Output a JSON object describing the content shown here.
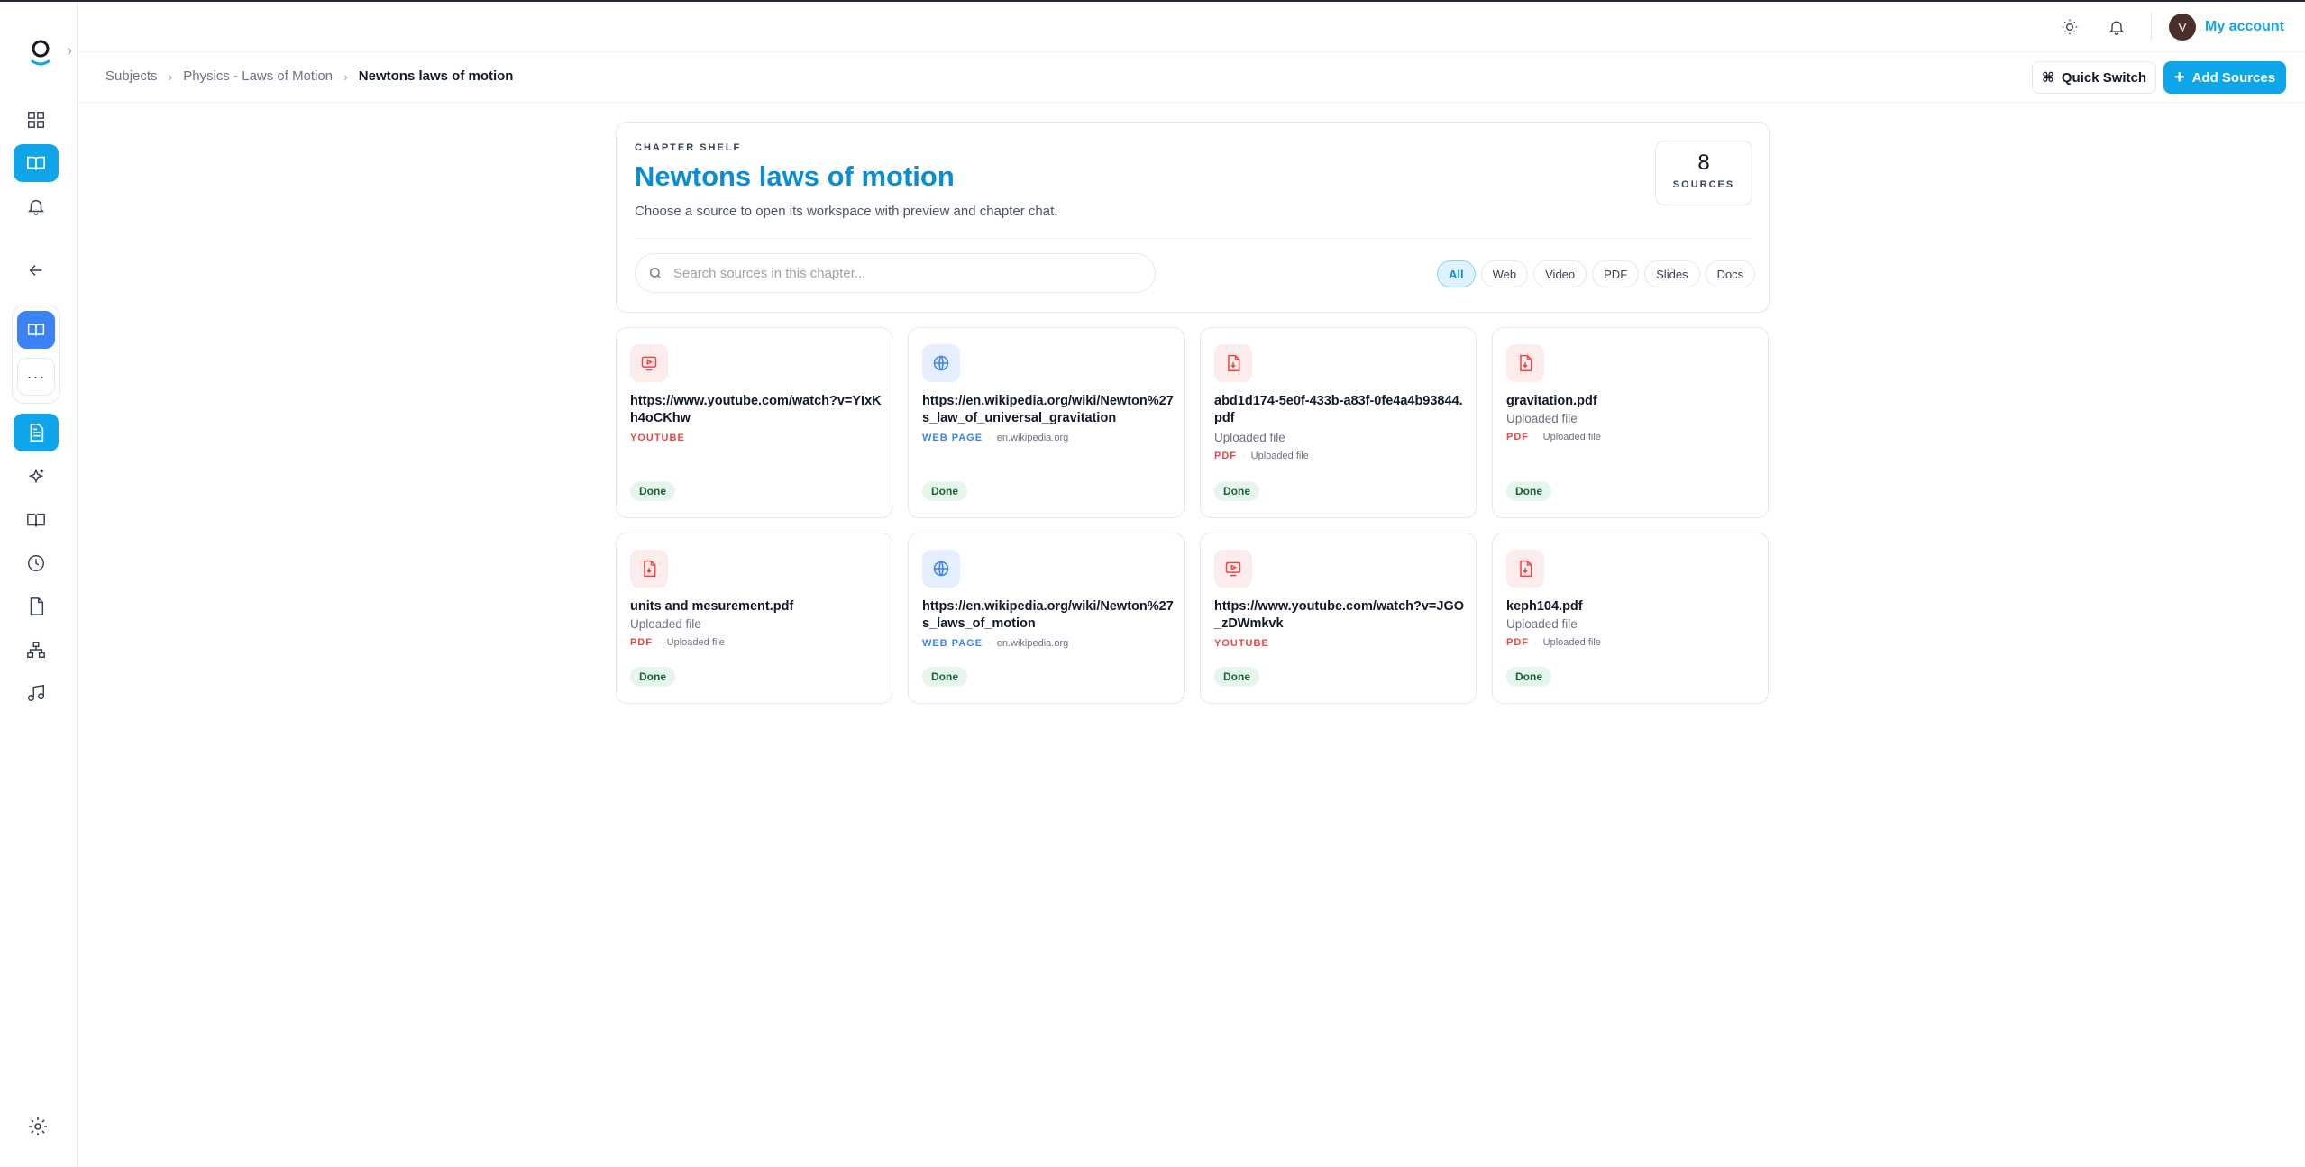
{
  "app": {
    "account_initial": "V",
    "account_label": "My account"
  },
  "breadcrumb": [
    "Subjects",
    "Physics - Laws of Motion",
    "Newtons laws of motion"
  ],
  "actions": {
    "quick_switch": "Quick Switch",
    "add_sources": "Add Sources"
  },
  "chapter": {
    "eyebrow": "CHAPTER SHELF",
    "title": "Newtons laws of motion",
    "subtitle": "Choose a source to open its workspace with preview and chapter chat.",
    "source_count": "8",
    "source_count_label": "SOURCES"
  },
  "search": {
    "placeholder": "Search sources in this chapter...",
    "value": ""
  },
  "filters": [
    "All",
    "Web",
    "Video",
    "PDF",
    "Slides",
    "Docs"
  ],
  "active_filter": "All",
  "cards": [
    {
      "icon": "video-icon",
      "name": "https://www.youtube.com/watch?v=YIxKh4oCKhw",
      "uploaded": "",
      "type": "YOUTUBE",
      "sub": "",
      "status": "Done"
    },
    {
      "icon": "globe-icon",
      "name": "https://en.wikipedia.org/wiki/Newton%27s_law_of_universal_gravitation",
      "uploaded": "",
      "type": "WEB PAGE",
      "sub": "en.wikipedia.org",
      "status": "Done"
    },
    {
      "icon": "pdf-icon",
      "name": "abd1d174-5e0f-433b-a83f-0fe4a4b93844.pdf",
      "uploaded": "Uploaded file",
      "type": "PDF",
      "sub": "Uploaded file",
      "status": "Done"
    },
    {
      "icon": "pdf-icon",
      "name": "gravitation.pdf",
      "uploaded": "Uploaded file",
      "type": "PDF",
      "sub": "Uploaded file",
      "status": "Done"
    },
    {
      "icon": "pdf-icon",
      "name": "units and mesurement.pdf",
      "uploaded": "Uploaded file",
      "type": "PDF",
      "sub": "Uploaded file",
      "status": "Done"
    },
    {
      "icon": "globe-icon",
      "name": "https://en.wikipedia.org/wiki/Newton%27s_laws_of_motion",
      "uploaded": "",
      "type": "WEB PAGE",
      "sub": "en.wikipedia.org",
      "status": "Done"
    },
    {
      "icon": "video-icon",
      "name": "https://www.youtube.com/watch?v=JGO_zDWmkvk",
      "uploaded": "",
      "type": "YOUTUBE",
      "sub": "",
      "status": "Done"
    },
    {
      "icon": "pdf-icon",
      "name": "keph104.pdf",
      "uploaded": "Uploaded file",
      "type": "PDF",
      "sub": "Uploaded file",
      "status": "Done"
    }
  ],
  "colors": {
    "accent": "#0ea5e9",
    "title": "#0b8ed1",
    "pdf": "#ef4444",
    "web": "#3b82f6",
    "done_bg": "#e6f6ee"
  }
}
